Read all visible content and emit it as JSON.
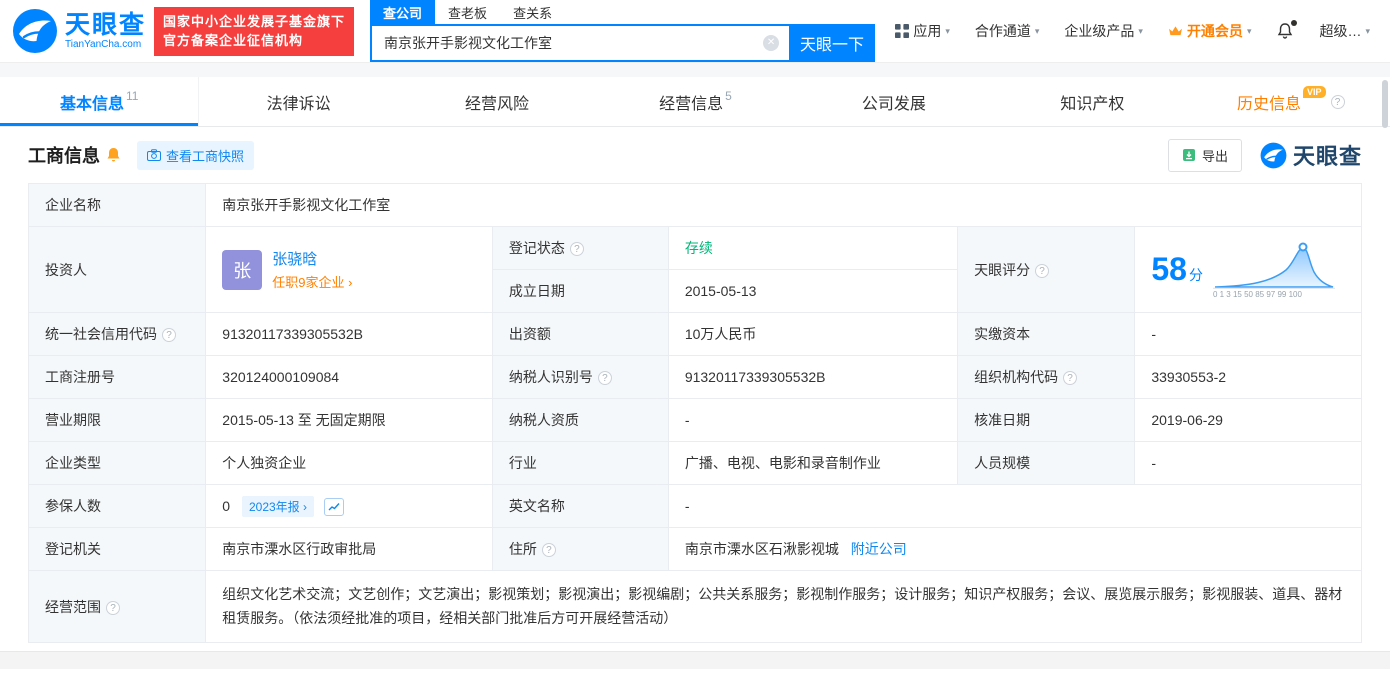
{
  "header": {
    "logo_title": "天眼查",
    "logo_domain": "TianYanCha.com",
    "badge_line1": "国家中小企业发展子基金旗下",
    "badge_line2": "官方备案企业征信机构",
    "search_tabs": [
      {
        "label": "查公司"
      },
      {
        "label": "查老板"
      },
      {
        "label": "查关系"
      }
    ],
    "search_value": "南京张开手影视文化工作室",
    "search_button": "天眼一下",
    "nav_app": "应用",
    "nav_coop": "合作通道",
    "nav_enterprise": "企业级产品",
    "nav_vip": "开通会员",
    "nav_super": "超级…"
  },
  "tabs": [
    {
      "label": "基本信息",
      "count": "11"
    },
    {
      "label": "法律诉讼",
      "count": ""
    },
    {
      "label": "经营风险",
      "count": ""
    },
    {
      "label": "经营信息",
      "count": "5"
    },
    {
      "label": "公司发展",
      "count": ""
    },
    {
      "label": "知识产权",
      "count": ""
    },
    {
      "label": "历史信息",
      "count": "",
      "vip": "VIP"
    }
  ],
  "section": {
    "title": "工商信息",
    "snapshot_button": "查看工商快照",
    "export_button": "导出",
    "brand": "天眼查"
  },
  "colors": {
    "brand_blue": "#0084ff",
    "status_green": "#00b578",
    "vip_orange": "#ff8000",
    "badge_red": "#f53f3f"
  },
  "table": {
    "company_name_label": "企业名称",
    "company_name": "南京张开手影视文化工作室",
    "investor_label": "投资人",
    "investor_avatar": "张",
    "investor_name": "张骁晗",
    "investor_jobs": "任职9家企业 ›",
    "reg_status_label": "登记状态",
    "reg_status": "存续",
    "establish_date_label": "成立日期",
    "establish_date": "2015-05-13",
    "score_label": "天眼评分",
    "score_value": "58",
    "score_unit": "分",
    "score_axis": "0 1 3 15 50 85 97 99 100",
    "credit_code_label": "统一社会信用代码",
    "credit_code": "91320117339305532B",
    "capital_label": "出资额",
    "capital": "10万人民币",
    "paid_capital_label": "实缴资本",
    "paid_capital": "-",
    "reg_number_label": "工商注册号",
    "reg_number": "320124000109084",
    "taxpayer_id_label": "纳税人识别号",
    "taxpayer_id": "91320117339305532B",
    "org_code_label": "组织机构代码",
    "org_code": "33930553-2",
    "business_term_label": "营业期限",
    "business_term": "2015-05-13 至 无固定期限",
    "taxpayer_quality_label": "纳税人资质",
    "taxpayer_quality": "-",
    "approval_date_label": "核准日期",
    "approval_date": "2019-06-29",
    "company_type_label": "企业类型",
    "company_type": "个人独资企业",
    "industry_label": "行业",
    "industry": "广播、电视、电影和录音制作业",
    "staff_size_label": "人员规模",
    "staff_size": "-",
    "insured_label": "参保人数",
    "insured": "0",
    "insured_report": "2023年报 ›",
    "english_name_label": "英文名称",
    "english_name": "-",
    "reg_authority_label": "登记机关",
    "reg_authority": "南京市溧水区行政审批局",
    "address_label": "住所",
    "address": "南京市溧水区石湫影视城",
    "address_nearby": "附近公司",
    "business_scope_label": "经营范围",
    "business_scope": "组织文化艺术交流；文艺创作；文艺演出；影视策划；影视演出；影视编剧；公共关系服务；影视制作服务；设计服务；知识产权服务；会议、展览展示服务；影视服装、道具、器材租赁服务。（依法须经批准的项目，经相关部门批准后方可开展经营活动）"
  }
}
